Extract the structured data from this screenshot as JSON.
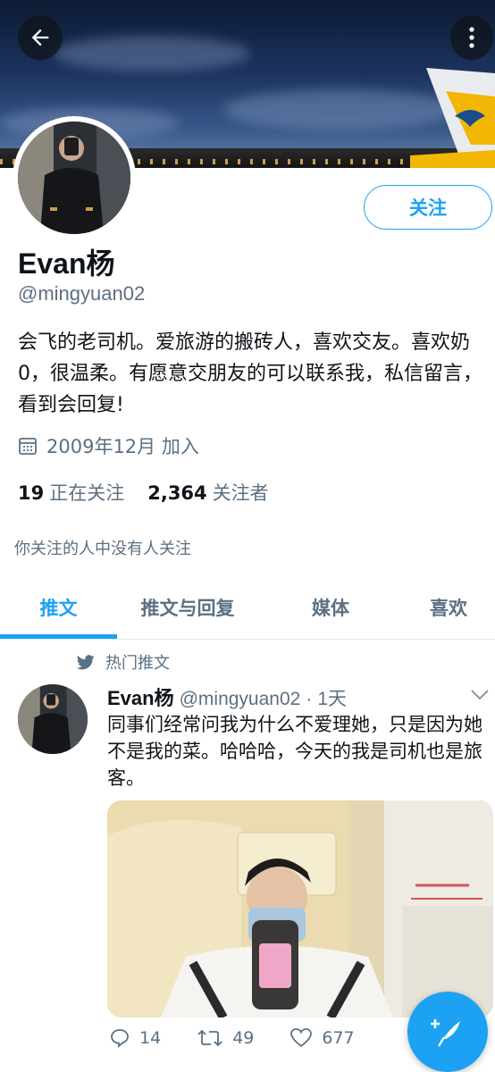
{
  "header": {
    "back_icon": "arrow-left-icon",
    "more_icon": "more-vertical-icon"
  },
  "profile": {
    "follow_label": "关注",
    "name": "Evan杨",
    "handle": "@mingyuan02",
    "bio": "会飞的老司机。爱旅游的搬砖人，喜欢交友。喜欢奶0，很温柔。有愿意交朋友的可以联系我，私信留言，看到会回复!",
    "joined": "2009年12月 加入",
    "following_count": "19",
    "following_label": "正在关注",
    "followers_count": "2,364",
    "followers_label": "关注者",
    "mutual_note": "你关注的人中没有人关注"
  },
  "tabs": [
    {
      "label": "推文"
    },
    {
      "label": "推文与回复"
    },
    {
      "label": "媒体"
    },
    {
      "label": "喜欢"
    }
  ],
  "tweet": {
    "pinned_label": "热门推文",
    "author_name": "Evan杨",
    "author_handle": "@mingyuan02",
    "separator": "·",
    "time": "1天",
    "text": "同事们经常问我为什么不爱理她，只是因为她不是我的菜。哈哈哈，今天的我是司机也是旅客。",
    "replies": "14",
    "retweets": "49",
    "likes": "677"
  },
  "colors": {
    "accent": "#1da1f2",
    "secondary_text": "#5b7083"
  }
}
